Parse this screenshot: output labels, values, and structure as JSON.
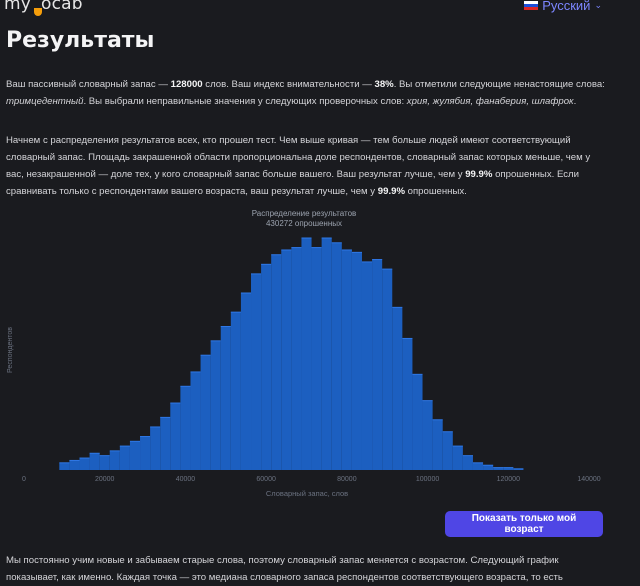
{
  "header": {
    "logo_left": "my",
    "logo_right": "ocab",
    "language": "Русский",
    "flag_colors": [
      "#ffffff",
      "#1d4ed8",
      "#dc2626"
    ]
  },
  "page": {
    "title": "Результаты"
  },
  "para1": {
    "t1": "Ваш пассивный словарный запас — ",
    "vocab": "128000",
    "t2": " слов. Ваш индекс внимательности — ",
    "attention": "38%",
    "t3": ". Вы отметили следующие ненастоящие слова: ",
    "fake_words": "тримцедентный",
    "t4": ". Вы выбрали неправильные значения у следующих проверочных слов: ",
    "wrong_words": "хрия, жулябия, фанаберия, шлафрок",
    "t5": "."
  },
  "para2": {
    "t1": "Начнем с распределения результатов всех, кто прошел тест. Чем выше кривая — тем больше людей имеют соответствующий словарный запас. Площадь закрашенной области пропорциональна доле респондентов, словарный запас которых меньше, чем у вас, незакрашенной — доле тех, у кого словарный запас больше вашего. Ваш результат лучше, чем у ",
    "pct_all": "99.9%",
    "t2": " опрошенных. Если сравнивать только с респондентами вашего возраста, ваш результат лучше, чем у ",
    "pct_age": "99.9%",
    "t3": " опрошенных."
  },
  "chart_data": {
    "type": "bar",
    "title": "Распределение результатов",
    "subtitle": "430272 опрошенных",
    "xlabel": "Словарный запас, слов",
    "ylabel": "Респондентов",
    "xlim": [
      0,
      140000
    ],
    "xticks": [
      "0",
      "20000",
      "40000",
      "60000",
      "80000",
      "100000",
      "120000",
      "140000"
    ],
    "bin_width": 2500,
    "x": [
      10000,
      12500,
      15000,
      17500,
      20000,
      22500,
      25000,
      27500,
      30000,
      32500,
      35000,
      37500,
      40000,
      42500,
      45000,
      47500,
      50000,
      52500,
      55000,
      57500,
      60000,
      62500,
      65000,
      67500,
      70000,
      72500,
      75000,
      77500,
      80000,
      82500,
      85000,
      87500,
      90000,
      92500,
      95000,
      97500,
      100000,
      102500,
      105000,
      107500,
      110000,
      112500,
      115000,
      117500,
      120000,
      122500
    ],
    "values": [
      3,
      4,
      5,
      7,
      6,
      8,
      10,
      12,
      14,
      18,
      22,
      28,
      35,
      41,
      48,
      54,
      60,
      66,
      74,
      82,
      86,
      90,
      92,
      93,
      97,
      93,
      97,
      95,
      92,
      91,
      87,
      88,
      84,
      68,
      55,
      40,
      29,
      21,
      16,
      10,
      6,
      3,
      2,
      1,
      1,
      0.5
    ],
    "color": "#1c5fc0",
    "edge_color": "#2f78e6"
  },
  "actions": {
    "age_button": "Показать только мой возраст"
  },
  "para3": {
    "t1": "Мы постоянно учим новые и забываем старые слова, поэтому словарный запас меняется с возрастом. Следующий график показывает, как именно. Каждая точка — это медиана словарного запаса респондентов соответствующего возраста, то есть"
  }
}
